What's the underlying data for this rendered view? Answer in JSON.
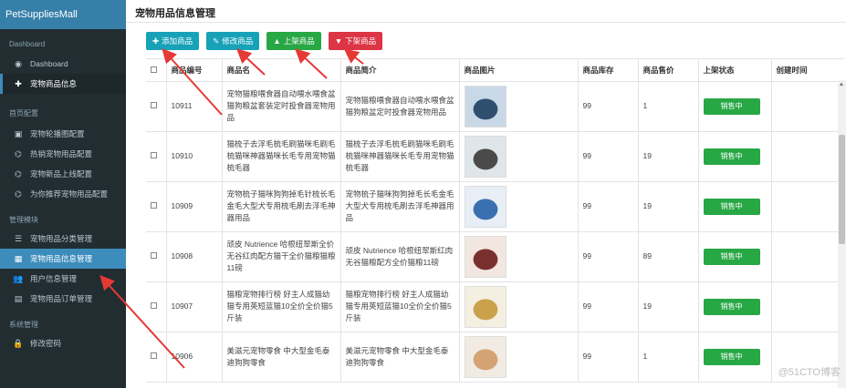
{
  "app": {
    "title": "PetSuppliesMall"
  },
  "sidebar": {
    "dashboard_header": "Dashboard",
    "dashboard_item": "Dashboard",
    "pet_goods_info": "宠物商品信息",
    "homepage_header": "首页配置",
    "homepage_items": [
      "宠物轮播图配置",
      "热销宠物用品配置",
      "宠物新品上线配置",
      "为你推荐宠物用品配置"
    ],
    "manage_header": "管理模块",
    "manage_items": [
      "宠物用品分类管理",
      "宠物用品信息管理",
      "用户信息管理",
      "宠物用品订单管理"
    ],
    "system_header": "系统管理",
    "system_items": [
      "修改密码"
    ]
  },
  "page": {
    "title": "宠物用品信息管理"
  },
  "toolbar": {
    "add_label": "添加商品",
    "edit_label": "修改商品",
    "up_label": "上架商品",
    "down_label": "下架商品"
  },
  "table": {
    "headers": [
      "商品编号",
      "商品名",
      "商品简介",
      "商品图片",
      "商品库存",
      "商品售价",
      "上架状态",
      "创建时间"
    ],
    "rows": [
      {
        "id": "10911",
        "name": "宠物猫粮喂食器自动喂水喂食盆猫狗粮盆套装定时投食器宠物用品",
        "desc": "宠物猫粮喂食器自动喂水喂食盆猫狗粮盆定时投食器宠物用品",
        "stock": "99",
        "price": "1",
        "status": "销售中",
        "created": ""
      },
      {
        "id": "10910",
        "name": "猫梳子去浮毛梳毛刷猫咪毛刷毛梳猫咪神器猫咪长毛专用宠物猫梳毛器",
        "desc": "猫梳子去浮毛梳毛刷猫咪毛刷毛梳猫咪神器猫咪长毛专用宠物猫梳毛器",
        "stock": "99",
        "price": "19",
        "status": "销售中",
        "created": ""
      },
      {
        "id": "10909",
        "name": "宠物梳子猫咪狗狗掉毛针梳长毛金毛大型犬专用梳毛刷去浮毛神器用品",
        "desc": "宠物梳子猫咪狗狗掉毛长毛金毛大型犬专用梳毛刷去浮毛神器用品",
        "stock": "99",
        "price": "19",
        "status": "销售中",
        "created": ""
      },
      {
        "id": "10908",
        "name": "顽皮 Nutrience 哈根纽翠斯全价无谷红肉配方猫干全价猫粮猫粮11磅",
        "desc": "顽皮 Nutrience 哈根纽翠斯红肉无谷猫粮配方全价猫粮11磅",
        "stock": "99",
        "price": "89",
        "status": "销售中",
        "created": ""
      },
      {
        "id": "10907",
        "name": "猫粮宠物排行榜 好主人成猫幼猫专用英短蓝猫10全价全价猫5斤装",
        "desc": "猫粮宠物排行榜 好主人成猫幼猫专用英短蓝猫10全价全价猫5斤装",
        "stock": "99",
        "price": "19",
        "status": "销售中",
        "created": ""
      },
      {
        "id": "10906",
        "name": "美滋元宠物零食 中大型金毛泰迪狗狗零食",
        "desc": "美滋元宠物零食 中大型金毛泰迪狗狗零食",
        "stock": "99",
        "price": "1",
        "status": "销售中",
        "created": ""
      }
    ]
  },
  "watermark": "@51CTO博客",
  "colors": {
    "sidebar_bg": "#222d32",
    "brand_bg": "#367fa9",
    "active": "#3c8dbc",
    "green": "#28a745",
    "red": "#dc3545",
    "teal": "#17a2b8",
    "arrow": "#e53935"
  }
}
